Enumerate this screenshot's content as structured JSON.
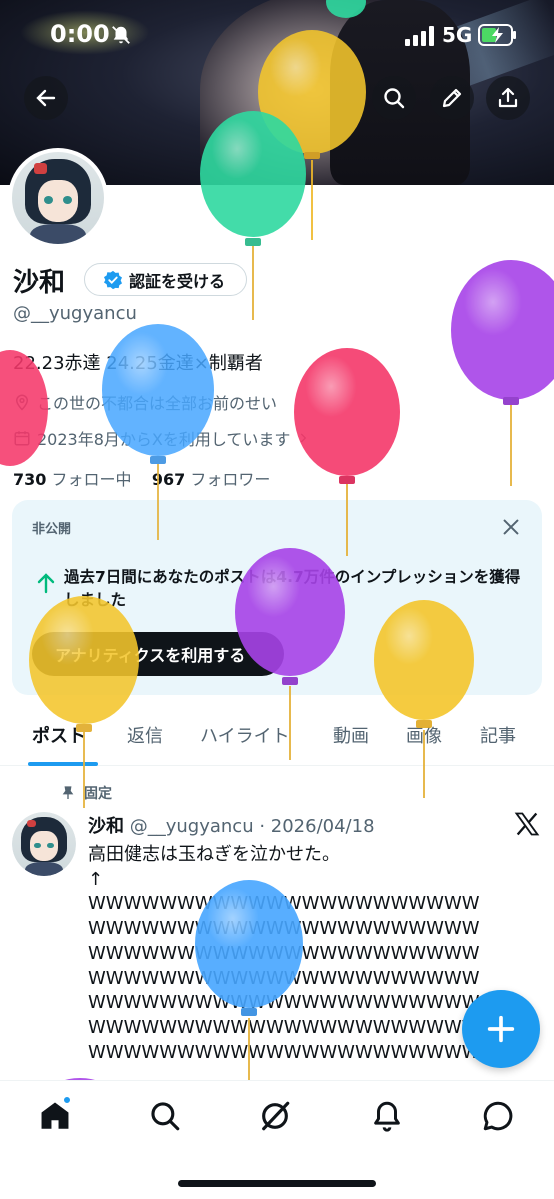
{
  "status_bar": {
    "time": "0:00",
    "network": "5G"
  },
  "profile": {
    "name": "沙和",
    "verify_button": "認証を受ける",
    "handle": "@__yugyancu",
    "bio": "22.23赤達  24.25金達×制覇者",
    "location": "この世の不都合は全部お前のせい",
    "joined": "2023年8月からXを利用しています",
    "following_count": "730",
    "following_label": "フォロー中",
    "followers_count": "967",
    "followers_label": "フォロワー"
  },
  "analytics_card": {
    "private_label": "非公開",
    "message": "過去7日間にあなたのポストは4.7万件のインプレッションを獲得しました",
    "button": "アナリティクスを利用する"
  },
  "tabs": [
    "ポスト",
    "返信",
    "ハイライト",
    "動画",
    "画像",
    "記事"
  ],
  "pinned_post": {
    "pinned_label": "固定",
    "author": "沙和",
    "handle_date": "@__yugyancu · 2026/04/18",
    "line1": "高田健志は玉ねぎを泣かせた。",
    "line2": "↑",
    "w_lines": [
      "WWWWWWWWWWWWWWWWWWWWWW",
      "WWWWWWWWWWWWWWWWWWWWWW",
      "WWWWWWWWWWWWWWWWWWWWWW",
      "WWWWWWWWWWWWWWWWWWWWWW",
      "WWWWWWWWWWWWWWWWWWWWWW",
      "WWWWWWWWWWWWWWWWWWWWWW",
      "WWWWWWWWWWWWWWWWWWWWWW"
    ]
  },
  "colors": {
    "accent": "#1d9bf0",
    "balloon_yellow": "#f4c62c",
    "balloon_green": "#2fd9a0",
    "balloon_blue": "#47a6ff",
    "balloon_red": "#f5386a",
    "balloon_purple": "#a743e8"
  }
}
